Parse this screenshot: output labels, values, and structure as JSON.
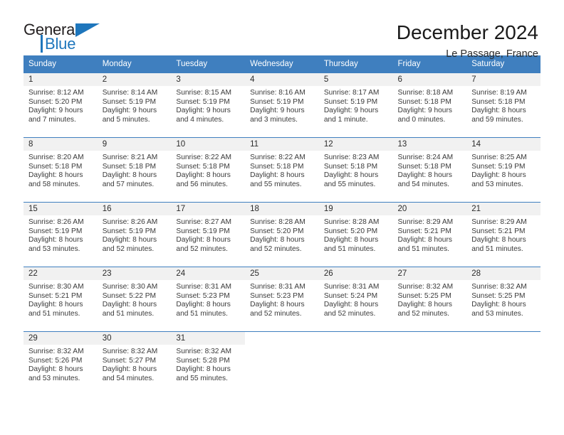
{
  "logo": {
    "word_one": "General",
    "word_two": "Blue",
    "triangle_icon": "blue-triangle-icon",
    "color_dark": "#231f20",
    "color_blue": "#1e76bc"
  },
  "header": {
    "title": "December 2024",
    "subtitle": "Le Passage, France"
  },
  "theme": {
    "header_bg": "#3f7fbf",
    "header_text": "#ffffff",
    "daynum_bg": "#f1f1f1",
    "body_text": "#3a3a3a",
    "rule": "#3f7fbf"
  },
  "weekday_headers": [
    "Sunday",
    "Monday",
    "Tuesday",
    "Wednesday",
    "Thursday",
    "Friday",
    "Saturday"
  ],
  "weeks": [
    [
      {
        "day": "1",
        "sunrise": "Sunrise: 8:12 AM",
        "sunset": "Sunset: 5:20 PM",
        "daylight1": "Daylight: 9 hours",
        "daylight2": "and 7 minutes."
      },
      {
        "day": "2",
        "sunrise": "Sunrise: 8:14 AM",
        "sunset": "Sunset: 5:19 PM",
        "daylight1": "Daylight: 9 hours",
        "daylight2": "and 5 minutes."
      },
      {
        "day": "3",
        "sunrise": "Sunrise: 8:15 AM",
        "sunset": "Sunset: 5:19 PM",
        "daylight1": "Daylight: 9 hours",
        "daylight2": "and 4 minutes."
      },
      {
        "day": "4",
        "sunrise": "Sunrise: 8:16 AM",
        "sunset": "Sunset: 5:19 PM",
        "daylight1": "Daylight: 9 hours",
        "daylight2": "and 3 minutes."
      },
      {
        "day": "5",
        "sunrise": "Sunrise: 8:17 AM",
        "sunset": "Sunset: 5:19 PM",
        "daylight1": "Daylight: 9 hours",
        "daylight2": "and 1 minute."
      },
      {
        "day": "6",
        "sunrise": "Sunrise: 8:18 AM",
        "sunset": "Sunset: 5:18 PM",
        "daylight1": "Daylight: 9 hours",
        "daylight2": "and 0 minutes."
      },
      {
        "day": "7",
        "sunrise": "Sunrise: 8:19 AM",
        "sunset": "Sunset: 5:18 PM",
        "daylight1": "Daylight: 8 hours",
        "daylight2": "and 59 minutes."
      }
    ],
    [
      {
        "day": "8",
        "sunrise": "Sunrise: 8:20 AM",
        "sunset": "Sunset: 5:18 PM",
        "daylight1": "Daylight: 8 hours",
        "daylight2": "and 58 minutes."
      },
      {
        "day": "9",
        "sunrise": "Sunrise: 8:21 AM",
        "sunset": "Sunset: 5:18 PM",
        "daylight1": "Daylight: 8 hours",
        "daylight2": "and 57 minutes."
      },
      {
        "day": "10",
        "sunrise": "Sunrise: 8:22 AM",
        "sunset": "Sunset: 5:18 PM",
        "daylight1": "Daylight: 8 hours",
        "daylight2": "and 56 minutes."
      },
      {
        "day": "11",
        "sunrise": "Sunrise: 8:22 AM",
        "sunset": "Sunset: 5:18 PM",
        "daylight1": "Daylight: 8 hours",
        "daylight2": "and 55 minutes."
      },
      {
        "day": "12",
        "sunrise": "Sunrise: 8:23 AM",
        "sunset": "Sunset: 5:18 PM",
        "daylight1": "Daylight: 8 hours",
        "daylight2": "and 55 minutes."
      },
      {
        "day": "13",
        "sunrise": "Sunrise: 8:24 AM",
        "sunset": "Sunset: 5:18 PM",
        "daylight1": "Daylight: 8 hours",
        "daylight2": "and 54 minutes."
      },
      {
        "day": "14",
        "sunrise": "Sunrise: 8:25 AM",
        "sunset": "Sunset: 5:19 PM",
        "daylight1": "Daylight: 8 hours",
        "daylight2": "and 53 minutes."
      }
    ],
    [
      {
        "day": "15",
        "sunrise": "Sunrise: 8:26 AM",
        "sunset": "Sunset: 5:19 PM",
        "daylight1": "Daylight: 8 hours",
        "daylight2": "and 53 minutes."
      },
      {
        "day": "16",
        "sunrise": "Sunrise: 8:26 AM",
        "sunset": "Sunset: 5:19 PM",
        "daylight1": "Daylight: 8 hours",
        "daylight2": "and 52 minutes."
      },
      {
        "day": "17",
        "sunrise": "Sunrise: 8:27 AM",
        "sunset": "Sunset: 5:19 PM",
        "daylight1": "Daylight: 8 hours",
        "daylight2": "and 52 minutes."
      },
      {
        "day": "18",
        "sunrise": "Sunrise: 8:28 AM",
        "sunset": "Sunset: 5:20 PM",
        "daylight1": "Daylight: 8 hours",
        "daylight2": "and 52 minutes."
      },
      {
        "day": "19",
        "sunrise": "Sunrise: 8:28 AM",
        "sunset": "Sunset: 5:20 PM",
        "daylight1": "Daylight: 8 hours",
        "daylight2": "and 51 minutes."
      },
      {
        "day": "20",
        "sunrise": "Sunrise: 8:29 AM",
        "sunset": "Sunset: 5:21 PM",
        "daylight1": "Daylight: 8 hours",
        "daylight2": "and 51 minutes."
      },
      {
        "day": "21",
        "sunrise": "Sunrise: 8:29 AM",
        "sunset": "Sunset: 5:21 PM",
        "daylight1": "Daylight: 8 hours",
        "daylight2": "and 51 minutes."
      }
    ],
    [
      {
        "day": "22",
        "sunrise": "Sunrise: 8:30 AM",
        "sunset": "Sunset: 5:21 PM",
        "daylight1": "Daylight: 8 hours",
        "daylight2": "and 51 minutes."
      },
      {
        "day": "23",
        "sunrise": "Sunrise: 8:30 AM",
        "sunset": "Sunset: 5:22 PM",
        "daylight1": "Daylight: 8 hours",
        "daylight2": "and 51 minutes."
      },
      {
        "day": "24",
        "sunrise": "Sunrise: 8:31 AM",
        "sunset": "Sunset: 5:23 PM",
        "daylight1": "Daylight: 8 hours",
        "daylight2": "and 51 minutes."
      },
      {
        "day": "25",
        "sunrise": "Sunrise: 8:31 AM",
        "sunset": "Sunset: 5:23 PM",
        "daylight1": "Daylight: 8 hours",
        "daylight2": "and 52 minutes."
      },
      {
        "day": "26",
        "sunrise": "Sunrise: 8:31 AM",
        "sunset": "Sunset: 5:24 PM",
        "daylight1": "Daylight: 8 hours",
        "daylight2": "and 52 minutes."
      },
      {
        "day": "27",
        "sunrise": "Sunrise: 8:32 AM",
        "sunset": "Sunset: 5:25 PM",
        "daylight1": "Daylight: 8 hours",
        "daylight2": "and 52 minutes."
      },
      {
        "day": "28",
        "sunrise": "Sunrise: 8:32 AM",
        "sunset": "Sunset: 5:25 PM",
        "daylight1": "Daylight: 8 hours",
        "daylight2": "and 53 minutes."
      }
    ],
    [
      {
        "day": "29",
        "sunrise": "Sunrise: 8:32 AM",
        "sunset": "Sunset: 5:26 PM",
        "daylight1": "Daylight: 8 hours",
        "daylight2": "and 53 minutes."
      },
      {
        "day": "30",
        "sunrise": "Sunrise: 8:32 AM",
        "sunset": "Sunset: 5:27 PM",
        "daylight1": "Daylight: 8 hours",
        "daylight2": "and 54 minutes."
      },
      {
        "day": "31",
        "sunrise": "Sunrise: 8:32 AM",
        "sunset": "Sunset: 5:28 PM",
        "daylight1": "Daylight: 8 hours",
        "daylight2": "and 55 minutes."
      },
      {
        "day": "",
        "sunrise": "",
        "sunset": "",
        "daylight1": "",
        "daylight2": ""
      },
      {
        "day": "",
        "sunrise": "",
        "sunset": "",
        "daylight1": "",
        "daylight2": ""
      },
      {
        "day": "",
        "sunrise": "",
        "sunset": "",
        "daylight1": "",
        "daylight2": ""
      },
      {
        "day": "",
        "sunrise": "",
        "sunset": "",
        "daylight1": "",
        "daylight2": ""
      }
    ]
  ]
}
